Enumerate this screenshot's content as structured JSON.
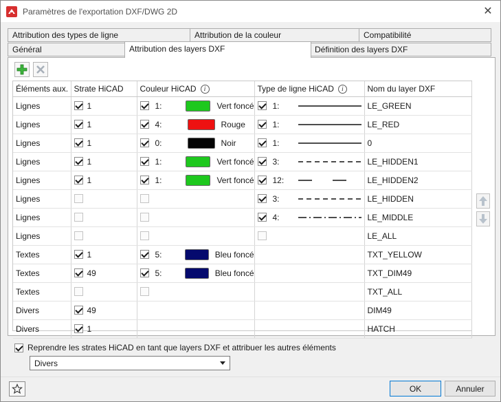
{
  "window": {
    "title": "Paramètres de l'exportation DXF/DWG 2D"
  },
  "tabs": {
    "row_back": [
      "Attribution des types de ligne",
      "Attribution de la couleur",
      "Compatibilité"
    ],
    "row_front": [
      "Général",
      "Attribution des layers DXF",
      "Définition des layers DXF"
    ],
    "active": "Attribution des layers DXF"
  },
  "toolbar": {
    "add_icon": "add-plus-icon",
    "delete_icon": "delete-x-icon"
  },
  "table": {
    "headers": [
      "Éléments aux.",
      "Strate HiCAD",
      "Couleur HiCAD",
      "Type de ligne HiCAD",
      "Nom du layer DXF"
    ],
    "header_info_icon": "info-icon",
    "colors": {
      "Vert foncé": "#1ec81e",
      "Rouge": "#ee1111",
      "Noir": "#050505",
      "Bleu foncé": "#050a6e"
    },
    "rows": [
      {
        "element": "Lignes",
        "strate_checked": true,
        "strate": "1",
        "color_checked": true,
        "color_num": "1:",
        "color_name": "Vert foncé",
        "line_checked": true,
        "line_num": "1:",
        "line_style": "solid",
        "layer": "LE_GREEN"
      },
      {
        "element": "Lignes",
        "strate_checked": true,
        "strate": "1",
        "color_checked": true,
        "color_num": "4:",
        "color_name": "Rouge",
        "line_checked": true,
        "line_num": "1:",
        "line_style": "solid",
        "layer": "LE_RED"
      },
      {
        "element": "Lignes",
        "strate_checked": true,
        "strate": "1",
        "color_checked": true,
        "color_num": "0:",
        "color_name": "Noir",
        "line_checked": true,
        "line_num": "1:",
        "line_style": "solid",
        "layer": "0"
      },
      {
        "element": "Lignes",
        "strate_checked": true,
        "strate": "1",
        "color_checked": true,
        "color_num": "1:",
        "color_name": "Vert foncé",
        "line_checked": true,
        "line_num": "3:",
        "line_style": "dashed",
        "layer": "LE_HIDDEN1"
      },
      {
        "element": "Lignes",
        "strate_checked": true,
        "strate": "1",
        "color_checked": true,
        "color_num": "1:",
        "color_name": "Vert foncé",
        "line_checked": true,
        "line_num": "12:",
        "line_style": "longdash",
        "layer": "LE_HIDDEN2"
      },
      {
        "element": "Lignes",
        "strate_checked": false,
        "strate": "",
        "color_checked": false,
        "color_num": "",
        "color_name": "",
        "line_checked": true,
        "line_num": "3:",
        "line_style": "dashed",
        "layer": "LE_HIDDEN"
      },
      {
        "element": "Lignes",
        "strate_checked": false,
        "strate": "",
        "color_checked": false,
        "color_num": "",
        "color_name": "",
        "line_checked": true,
        "line_num": "4:",
        "line_style": "dashdot",
        "layer": "LE_MIDDLE"
      },
      {
        "element": "Lignes",
        "strate_checked": false,
        "strate": "",
        "color_checked": false,
        "color_num": "",
        "color_name": "",
        "line_checked": false,
        "line_num": "",
        "line_style": "",
        "layer": "LE_ALL"
      },
      {
        "element": "Textes",
        "strate_checked": true,
        "strate": "1",
        "color_checked": true,
        "color_num": "5:",
        "color_name": "Bleu foncé",
        "line_checked": null,
        "line_num": "",
        "line_style": "",
        "layer": "TXT_YELLOW"
      },
      {
        "element": "Textes",
        "strate_checked": true,
        "strate": "49",
        "color_checked": true,
        "color_num": "5:",
        "color_name": "Bleu foncé",
        "line_checked": null,
        "line_num": "",
        "line_style": "",
        "layer": "TXT_DIM49"
      },
      {
        "element": "Textes",
        "strate_checked": false,
        "strate": "",
        "color_checked": false,
        "color_num": "",
        "color_name": "",
        "line_checked": null,
        "line_num": "",
        "line_style": "",
        "layer": "TXT_ALL"
      },
      {
        "element": "Divers",
        "strate_checked": true,
        "strate": "49",
        "color_checked": null,
        "color_num": "",
        "color_name": "",
        "line_checked": null,
        "line_num": "",
        "line_style": "",
        "layer": "DIM49"
      },
      {
        "element": "Divers",
        "strate_checked": true,
        "strate": "1",
        "color_checked": null,
        "color_num": "",
        "color_name": "",
        "line_checked": null,
        "line_num": "",
        "line_style": "",
        "layer": "HATCH"
      }
    ]
  },
  "side": {
    "up_icon": "move-up-arrow-icon",
    "down_icon": "move-down-arrow-icon"
  },
  "option": {
    "checked": true,
    "label": "Reprendre les strates HiCAD en tant que layers DXF et attribuer les autres éléments",
    "select_value": "Divers"
  },
  "footer": {
    "ok_label": "OK",
    "cancel_label": "Annuler",
    "favorite_icon": "star-icon"
  }
}
